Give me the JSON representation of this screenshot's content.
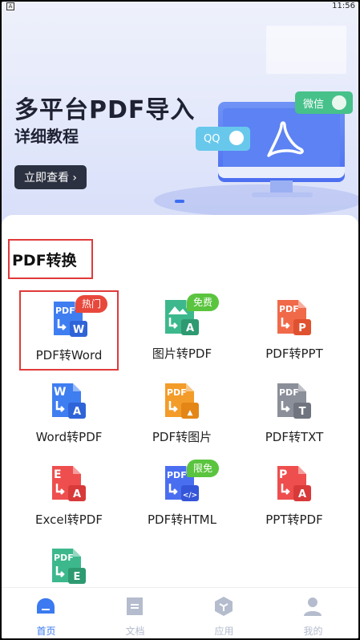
{
  "status_bar": {
    "time": "11:56",
    "left_glyph": "A"
  },
  "banner": {
    "title": "多平台PDF导入",
    "subtitle": "详细教程",
    "button_label": "立即查看 ›",
    "qq_label": "QQ",
    "wechat_label": "微信"
  },
  "section": {
    "title": "PDF转换"
  },
  "tools": [
    {
      "label": "PDF转Word",
      "icon": "pdf-to-word-icon",
      "badge": "热门",
      "color": "#3f7ef0",
      "accent": "#2f64d8",
      "top_text": "PDF",
      "corner": "W"
    },
    {
      "label": "图片转PDF",
      "icon": "image-to-pdf-icon",
      "badge": "免费",
      "color": "#3db88d",
      "accent": "#2e9a72",
      "top_text": "",
      "corner": "A"
    },
    {
      "label": "PDF转PPT",
      "icon": "pdf-to-ppt-icon",
      "badge": "",
      "color": "#f06a4a",
      "accent": "#e0522f",
      "top_text": "PDF",
      "corner": "P"
    },
    {
      "label": "Word转PDF",
      "icon": "word-to-pdf-icon",
      "badge": "",
      "color": "#3f7ef0",
      "accent": "#2f64d8",
      "top_text": "W",
      "corner": "A"
    },
    {
      "label": "PDF转图片",
      "icon": "pdf-to-image-icon",
      "badge": "",
      "color": "#f39c2a",
      "accent": "#e38616",
      "top_text": "PDF",
      "corner": "img"
    },
    {
      "label": "PDF转TXT",
      "icon": "pdf-to-txt-icon",
      "badge": "",
      "color": "#8a8f99",
      "accent": "#6f747e",
      "top_text": "PDF",
      "corner": "T"
    },
    {
      "label": "Excel转PDF",
      "icon": "excel-to-pdf-icon",
      "badge": "",
      "color": "#ee4e4e",
      "accent": "#d83a3a",
      "top_text": "E",
      "corner": "A"
    },
    {
      "label": "PDF转HTML",
      "icon": "pdf-to-html-icon",
      "badge": "限免",
      "color": "#4a6ef0",
      "accent": "#3556d8",
      "top_text": "PDF",
      "corner": "</>"
    },
    {
      "label": "PPT转PDF",
      "icon": "ppt-to-pdf-icon",
      "badge": "",
      "color": "#ee4e4e",
      "accent": "#d83a3a",
      "top_text": "P",
      "corner": "A"
    },
    {
      "label": "",
      "icon": "pdf-to-excel-icon",
      "badge": "",
      "color": "#3db88d",
      "accent": "#2e9a72",
      "top_text": "PDF",
      "corner": "E"
    }
  ],
  "tabbar": [
    {
      "label": "首页",
      "icon": "home-icon",
      "active": true
    },
    {
      "label": "文档",
      "icon": "document-icon",
      "active": false
    },
    {
      "label": "应用",
      "icon": "apps-icon",
      "active": false
    },
    {
      "label": "我的",
      "icon": "profile-icon",
      "active": false
    }
  ],
  "colors": {
    "active_tab": "#3b7af0",
    "inactive_tab": "#b4bccd",
    "highlight_border": "#e03a3a"
  }
}
